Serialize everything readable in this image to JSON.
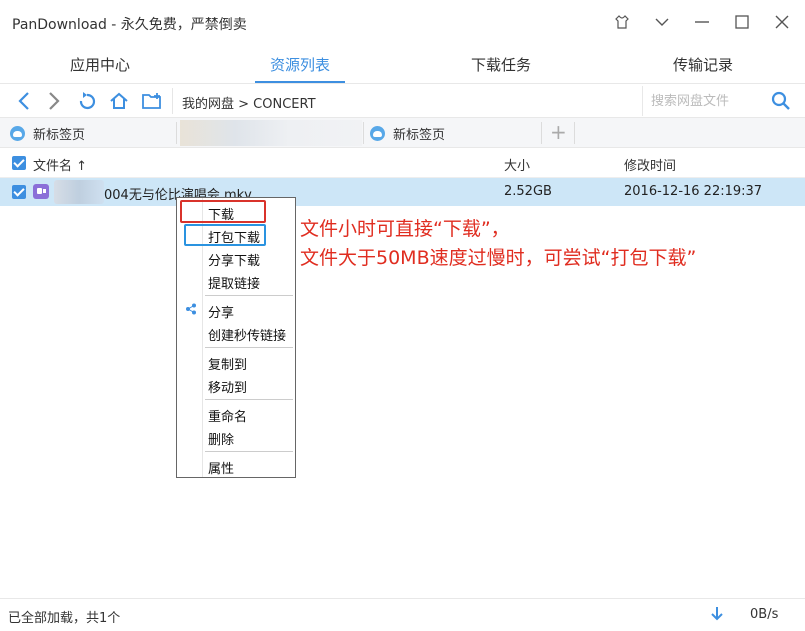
{
  "window": {
    "title": "PanDownload - 永久免费，严禁倒卖"
  },
  "tabs": [
    {
      "label": "应用中心",
      "active": false
    },
    {
      "label": "资源列表",
      "active": true
    },
    {
      "label": "下载任务",
      "active": false
    },
    {
      "label": "传输记录",
      "active": false
    }
  ],
  "toolbar": {
    "breadcrumb": "我的网盘 > CONCERT",
    "search_placeholder": "搜索网盘文件"
  },
  "file_tabs": [
    {
      "label": "新标签页"
    },
    {
      "label": "新标签页"
    }
  ],
  "list": {
    "headers": {
      "name": "文件名",
      "sort_arrow": "↑",
      "size": "大小",
      "modified": "修改时间"
    },
    "rows": [
      {
        "name": "004无与伦比演唱会.mkv",
        "size": "2.52GB",
        "modified": "2016-12-16 22:19:37",
        "selected": true
      }
    ]
  },
  "context_menu": {
    "items": [
      {
        "label": "下载"
      },
      {
        "label": "打包下载"
      },
      {
        "label": "分享下载"
      },
      {
        "label": "提取链接"
      },
      {
        "label": "分享",
        "icon": "share-icon"
      },
      {
        "label": "创建秒传链接"
      },
      {
        "label": "复制到"
      },
      {
        "label": "移动到"
      },
      {
        "label": "重命名"
      },
      {
        "label": "删除"
      },
      {
        "label": "属性"
      }
    ]
  },
  "annotation": {
    "line1": "文件小时可直接“下载”，",
    "line2": "文件大于50MB速度过慢时，可尝试“打包下载”"
  },
  "status": {
    "text": "已全部加载，共1个",
    "speed": "0B/s"
  },
  "colors": {
    "accent": "#3d8fe0",
    "selected_row": "#cde6f7",
    "annotation": "#e02d20",
    "highlight_red": "#d9332b",
    "highlight_blue": "#2a93e0"
  }
}
